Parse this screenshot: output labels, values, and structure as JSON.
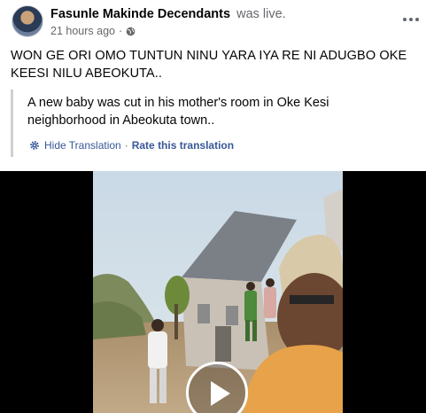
{
  "post": {
    "author_name": "Fasunle Makinde Decendants",
    "status_text": "was live.",
    "timestamp": "21 hours ago",
    "separator": "·",
    "privacy_icon": "globe-icon",
    "more_icon": "more-options-icon",
    "body_text": "WON GE ORI OMO TUNTUN NINU YARA IYA RE NI ADUGBO OKE KEESI NILU ABEOKUTA.."
  },
  "translation": {
    "text": "A new baby was cut in his mother's room in Oke Kesi neighborhood in Abeokuta town..",
    "hide_label": "Hide Translation",
    "separator": "·",
    "rate_label": "Rate this translation",
    "icon": "gear-icon"
  },
  "video": {
    "play_icon": "play-icon"
  },
  "colors": {
    "secondary_text": "#65676b",
    "link": "#385898",
    "quote_border": "#ced0d4",
    "video_background": "#000000"
  }
}
